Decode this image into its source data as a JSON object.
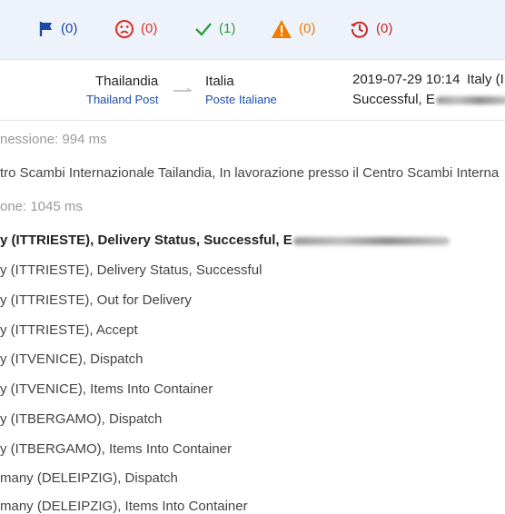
{
  "filters": [
    {
      "name": "flag",
      "count": "(0)",
      "color": "#1a47a8"
    },
    {
      "name": "sad-face",
      "count": "(0)",
      "color": "#d93025"
    },
    {
      "name": "check",
      "count": "(1)",
      "color": "#2e9e3e"
    },
    {
      "name": "warning",
      "count": "(0)",
      "color": "#f07c00"
    },
    {
      "name": "history",
      "count": "(0)",
      "color": "#c62828"
    }
  ],
  "route": {
    "origin_country": "Thailandia",
    "origin_carrier": "Thailand Post",
    "destination_country": "Italia",
    "destination_carrier": "Poste Italiane",
    "latest_datetime": "2019-07-29 10:14",
    "latest_location": "Italy (I",
    "latest_status": "Successful, E"
  },
  "events": {
    "meta_1": "nessione: 994 ms",
    "origin_event": "tro Scambi Internazionale Tailandia, In lavorazione presso il Centro Scambi Interna",
    "meta_2": "one: 1045 ms",
    "lines": [
      "y (ITTRIESTE), Delivery Status, Successful, E",
      "y (ITTRIESTE), Delivery Status, Successful",
      "y (ITTRIESTE), Out for Delivery",
      "y (ITTRIESTE), Accept",
      "y (ITVENICE), Dispatch",
      "y (ITVENICE), Items Into Container",
      "y (ITBERGAMO), Dispatch",
      "y (ITBERGAMO), Items Into Container",
      "many (DELEIPZIG), Dispatch",
      "many (DELEIPZIG), Items Into Container"
    ]
  }
}
